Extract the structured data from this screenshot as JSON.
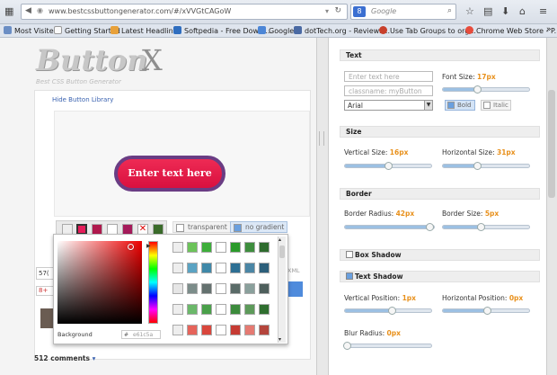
{
  "browser": {
    "url": "www.bestcssbuttongenerator.com/#/xVVGtCAGoW",
    "search_placeholder": "Google",
    "search_engine": "8"
  },
  "bookmarks": [
    {
      "label": "Most Visited",
      "color": "#6b8ec4"
    },
    {
      "label": "Getting Started",
      "color": "#f0f0f0"
    },
    {
      "label": "Latest Headlines",
      "color": "#e8a13a"
    },
    {
      "label": "Softpedia - Free Downl...",
      "color": "#2f6ebf"
    },
    {
      "label": "Google",
      "color": "#4c86d6"
    },
    {
      "label": "dotTech.org - Reviews...",
      "color": "#4a6aa3"
    },
    {
      "label": "Use Tab Groups to org...",
      "color": "#c8402c"
    },
    {
      "label": "Chrome Web Store - P...",
      "color": "#e74c3c"
    }
  ],
  "left": {
    "logo_word": "Button",
    "logo_x": "X",
    "logo_sub": "Best CSS Button Generator",
    "hide_library": "Hide Button Library",
    "button_text": "Enter text here",
    "transparent_label": "transparent",
    "no_gradient_label": "no gradient",
    "bg_label": "Background",
    "hex_value": "e61c5a",
    "hex_prefix": "#",
    "frag_count": "57(",
    "frag_g": "8+",
    "frag_xml": "XML",
    "comments": "512 comments"
  },
  "panel": {
    "text": {
      "title": "Text",
      "text_placeholder": "Enter text here",
      "class_placeholder": "classname: myButton",
      "font_size_label": "Font Size:",
      "font_size_value": "17px",
      "font_family": "Arial",
      "bold_label": "Bold",
      "italic_label": "Italic"
    },
    "size": {
      "title": "Size",
      "vertical_label": "Vertical Size:",
      "vertical_value": "16px",
      "horizontal_label": "Horizontal Size:",
      "horizontal_value": "31px"
    },
    "border": {
      "title": "Border",
      "radius_label": "Border Radius:",
      "radius_value": "42px",
      "size_label": "Border Size:",
      "size_value": "5px"
    },
    "box_shadow": {
      "title": "Box Shadow"
    },
    "text_shadow": {
      "title": "Text Shadow",
      "vertical_label": "Vertical Position:",
      "vertical_value": "1px",
      "horizontal_label": "Horizontal Position:",
      "horizontal_value": "0px",
      "blur_label": "Blur Radius:",
      "blur_value": "0px"
    }
  },
  "colors": {
    "button_fill": "#e61c5a",
    "button_border": "#6a3d84",
    "accent_value": "#e8901b"
  }
}
